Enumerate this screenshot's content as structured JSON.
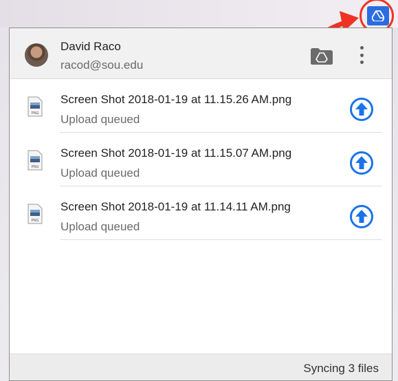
{
  "user": {
    "name": "David Raco",
    "email": "racod@sou.edu"
  },
  "files": [
    {
      "name": "Screen Shot 2018-01-19 at 11.15.26 AM.png",
      "status": "Upload queued",
      "type_label": "PNG"
    },
    {
      "name": "Screen Shot 2018-01-19 at 11.15.07 AM.png",
      "status": "Upload queued",
      "type_label": "PNG"
    },
    {
      "name": "Screen Shot 2018-01-19 at 11.14.11 AM.png",
      "status": "Upload queued",
      "type_label": "PNG"
    }
  ],
  "footer": {
    "status": "Syncing 3 files"
  },
  "icons": {
    "tray": "google-drive-icon",
    "open_folder": "drive-folder-icon",
    "menu": "more-vertical-icon",
    "upload": "upload-arrow-icon",
    "file": "png-file-icon"
  },
  "colors": {
    "accent": "#2b6de0",
    "upload_blue": "#1a73e8",
    "annotation_red": "#ee3322"
  }
}
